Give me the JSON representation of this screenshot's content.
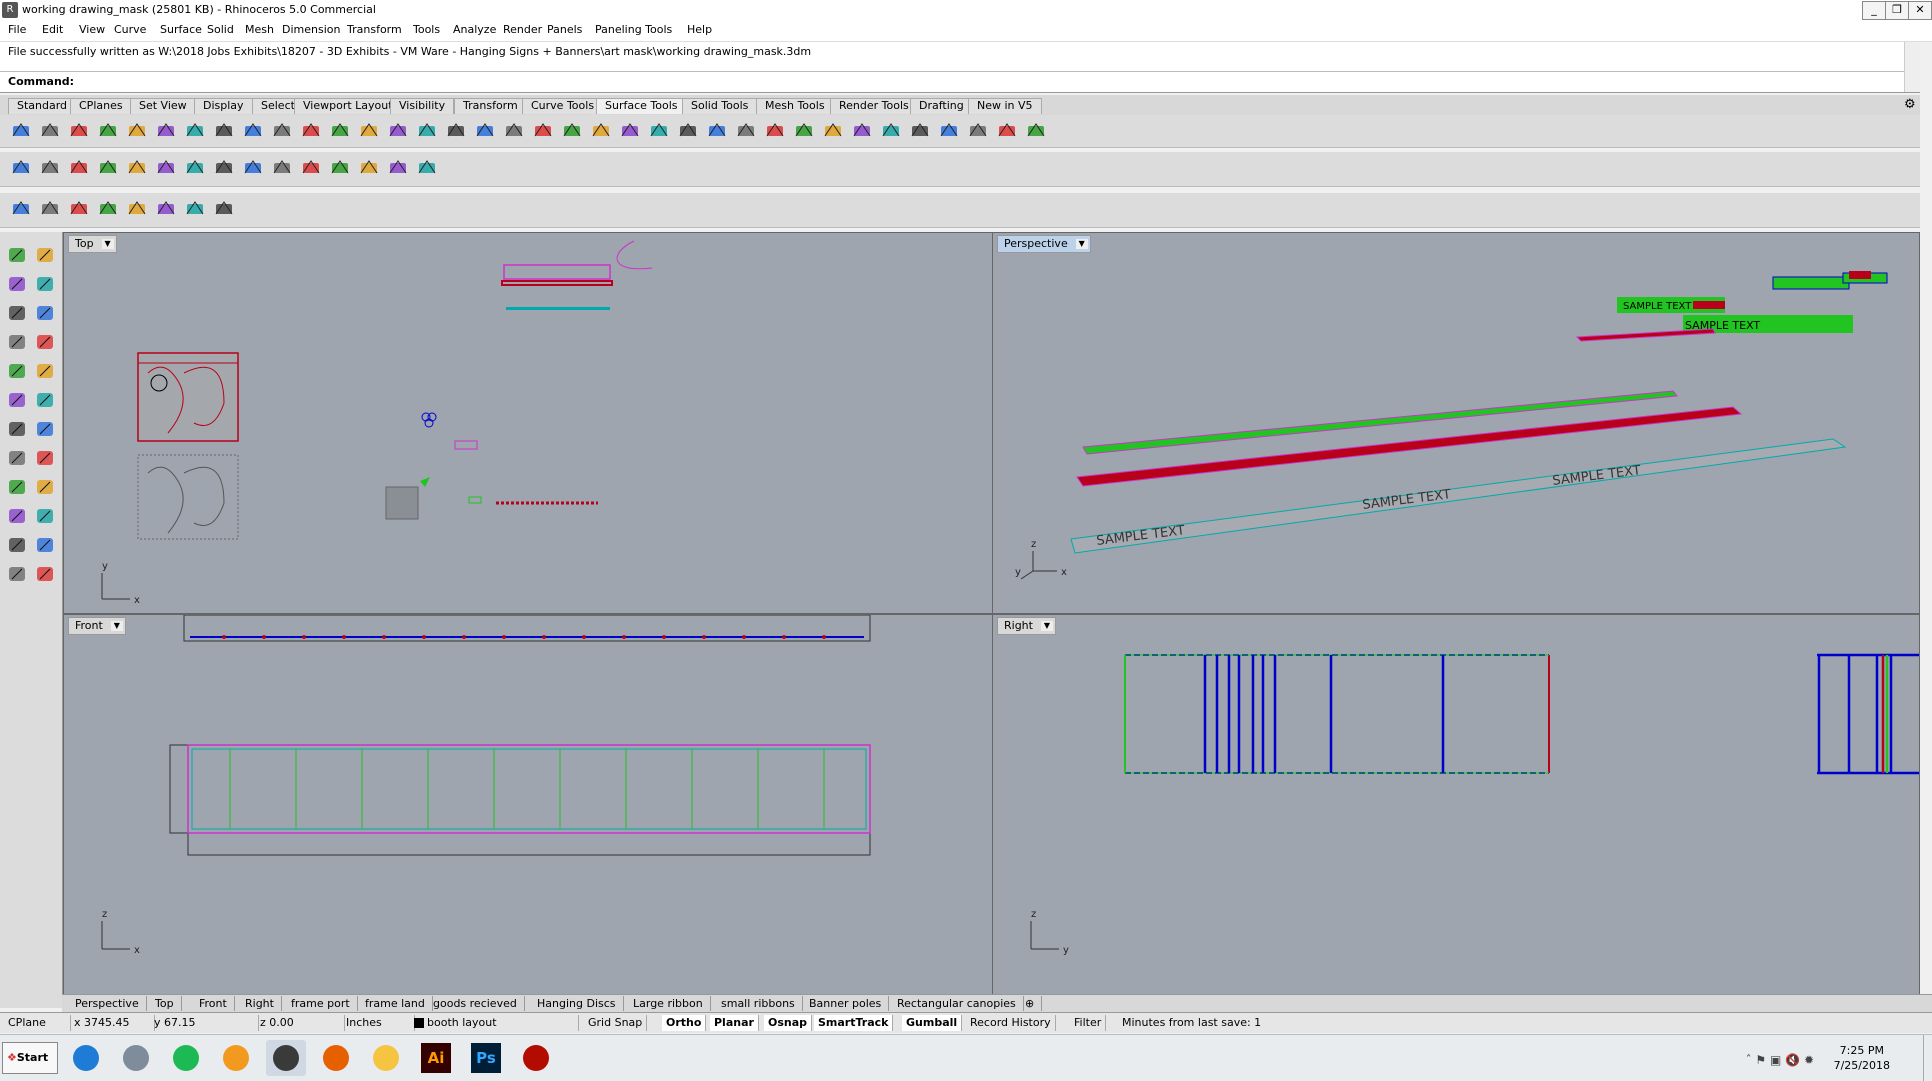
{
  "window": {
    "title": "working drawing_mask (25801 KB) - Rhinoceros 5.0 Commercial",
    "controls": [
      "_",
      "❒",
      "✕"
    ]
  },
  "menu": [
    "File",
    "Edit",
    "View",
    "Curve",
    "Surface",
    "Solid",
    "Mesh",
    "Dimension",
    "Transform",
    "Tools",
    "Analyze",
    "Render",
    "Panels",
    "Paneling Tools",
    "Help"
  ],
  "command": {
    "history": "File successfully written as W:\\2018 Jobs Exhibits\\18207 - 3D Exhibits - VM Ware - Hanging Signs + Banners\\art mask\\working drawing_mask.3dm",
    "prompt": "Command:"
  },
  "toolbar_tabs": [
    "Standard",
    "CPlanes",
    "Set View",
    "Display",
    "Select",
    "Viewport Layout",
    "Visibility",
    "Transform",
    "Curve Tools",
    "Surface Tools",
    "Solid Tools",
    "Mesh Tools",
    "Render Tools",
    "Drafting",
    "New in V5"
  ],
  "toolbar_tabs_active": "Surface Tools",
  "viewports": {
    "top": {
      "label": "Top",
      "axes": [
        "y",
        "x"
      ]
    },
    "perspective": {
      "label": "Perspective",
      "axes": [
        "z",
        "y",
        "x"
      ],
      "sample_text": "SAMPLE TEXT"
    },
    "front": {
      "label": "Front",
      "axes": [
        "z",
        "x"
      ]
    },
    "right": {
      "label": "Right",
      "axes": [
        "z",
        "y"
      ]
    }
  },
  "viewport_tabs": [
    "Perspective",
    "Top",
    "Front",
    "Right",
    "frame port",
    "frame land",
    "goods recieved",
    "Hanging Discs",
    "Large ribbon",
    "small ribbons",
    "Banner poles",
    "Rectangular canopies",
    "⊕"
  ],
  "status": {
    "cplane": "CPlane",
    "x": "x 3745.45",
    "y": "y 67.15",
    "z": "z 0.00",
    "units": "Inches",
    "layer": "booth layout",
    "toggles": [
      {
        "label": "Grid Snap",
        "on": false
      },
      {
        "label": "Ortho",
        "on": true
      },
      {
        "label": "Planar",
        "on": true
      },
      {
        "label": "Osnap",
        "on": true
      },
      {
        "label": "SmartTrack",
        "on": true
      },
      {
        "label": "Gumball",
        "on": true
      },
      {
        "label": "Record History",
        "on": false
      },
      {
        "label": "Filter",
        "on": false
      }
    ],
    "autosave": "Minutes from last save: 1"
  },
  "taskbar": {
    "start": "Start",
    "apps": [
      {
        "name": "internet-explorer-icon",
        "color": "#1e7bd6"
      },
      {
        "name": "calculator-icon",
        "color": "#7f8c9b"
      },
      {
        "name": "spotify-icon",
        "color": "#1db954"
      },
      {
        "name": "outlook-icon",
        "color": "#f29a1f"
      },
      {
        "name": "rhino-icon",
        "color": "#3a3a3a"
      },
      {
        "name": "firefox-icon",
        "color": "#e66000"
      },
      {
        "name": "file-explorer-icon",
        "color": "#f5c542"
      },
      {
        "name": "illustrator-icon",
        "color": "#330000"
      },
      {
        "name": "photoshop-icon",
        "color": "#001e36"
      },
      {
        "name": "acrobat-icon",
        "color": "#b30b00"
      }
    ],
    "ai_label": "Ai",
    "ps_label": "Ps",
    "time": "7:25 PM",
    "date": "7/25/2018"
  },
  "colors": {
    "viewport_bg": "#9ea5ae",
    "green": "#22c422",
    "red": "#b8001a",
    "blue": "#0000cc",
    "magenta": "#cc33cc"
  }
}
